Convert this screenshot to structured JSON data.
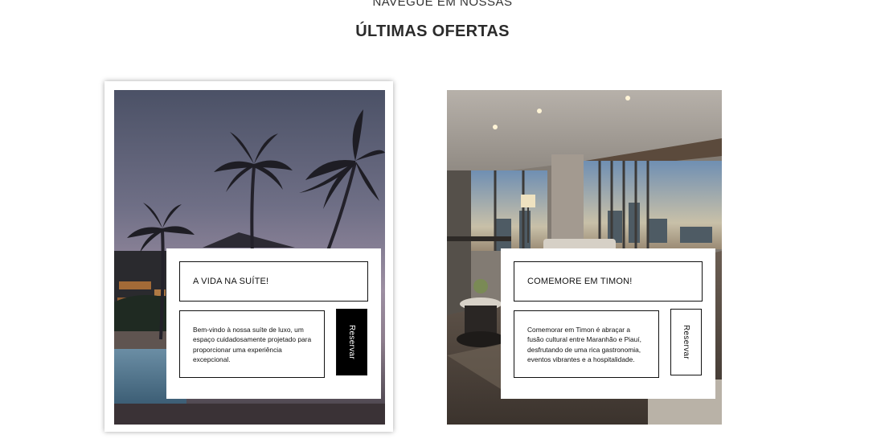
{
  "section": {
    "kicker": "NAVEGUE EM NOSSAS",
    "title": "ÚLTIMAS OFERTAS"
  },
  "offers": [
    {
      "title": "A VIDA NA SUÍTE!",
      "description": "Bem-vindo à nossa suíte de luxo, um espaço cuidadosamente projetado para proporcionar uma experiência excepcional.",
      "button_label": "Reservar",
      "image": "resort-palm-trees-dusk",
      "button_style": "dark"
    },
    {
      "title": "COMEMORE EM TIMON!",
      "description": "Comemorar em Timon é abraçar a fusão cultural entre Maranhão e Piauí, desfrutando de uma rica gastronomia, eventos vibrantes e a hospitalidade.",
      "button_label": "Reservar",
      "image": "luxury-apartment-interior",
      "button_style": "light"
    }
  ]
}
